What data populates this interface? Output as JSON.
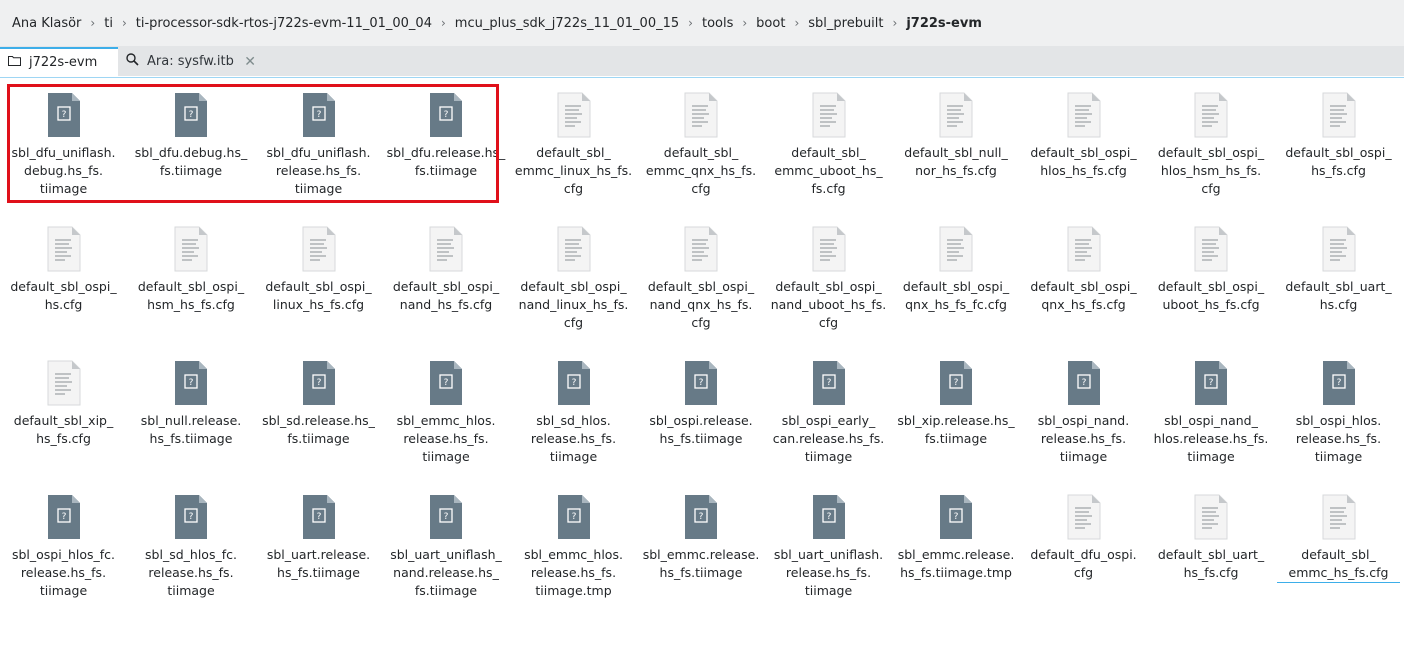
{
  "breadcrumb": {
    "items": [
      "Ana Klasör",
      "ti",
      "ti-processor-sdk-rtos-j722s-evm-11_01_00_04",
      "mcu_plus_sdk_j722s_11_01_00_15",
      "tools",
      "boot",
      "sbl_prebuilt",
      "j722s-evm"
    ],
    "separator": "›"
  },
  "tabs": [
    {
      "label": "j722s-evm",
      "icon": "folder-icon",
      "active": true
    },
    {
      "label": "Ara: sysfw.itb",
      "icon": "search-icon",
      "active": false,
      "close": "✕"
    }
  ],
  "colors": {
    "accent": "#3daee9",
    "selection": "#e0101a",
    "binary_icon": "#677a87",
    "text_icon": "#f5f5f5"
  },
  "files": [
    {
      "name": "sbl_dfu_uniflash.\ndebug.hs_fs.\ntiimage",
      "type": "binary"
    },
    {
      "name": "sbl_dfu.debug.hs_\nfs.tiimage",
      "type": "binary"
    },
    {
      "name": "sbl_dfu_uniflash.\nrelease.hs_fs.\ntiimage",
      "type": "binary"
    },
    {
      "name": "sbl_dfu.release.hs_\nfs.tiimage",
      "type": "binary"
    },
    {
      "name": "default_sbl_\nemmc_linux_hs_fs.\ncfg",
      "type": "text"
    },
    {
      "name": "default_sbl_\nemmc_qnx_hs_fs.\ncfg",
      "type": "text"
    },
    {
      "name": "default_sbl_\nemmc_uboot_hs_\nfs.cfg",
      "type": "text"
    },
    {
      "name": "default_sbl_null_\nnor_hs_fs.cfg",
      "type": "text"
    },
    {
      "name": "default_sbl_ospi_\nhlos_hs_fs.cfg",
      "type": "text"
    },
    {
      "name": "default_sbl_ospi_\nhlos_hsm_hs_fs.\ncfg",
      "type": "text"
    },
    {
      "name": "default_sbl_ospi_\nhs_fs.cfg",
      "type": "text"
    },
    {
      "name": "default_sbl_ospi_\nhs.cfg",
      "type": "text"
    },
    {
      "name": "default_sbl_ospi_\nhsm_hs_fs.cfg",
      "type": "text"
    },
    {
      "name": "default_sbl_ospi_\nlinux_hs_fs.cfg",
      "type": "text"
    },
    {
      "name": "default_sbl_ospi_\nnand_hs_fs.cfg",
      "type": "text"
    },
    {
      "name": "default_sbl_ospi_\nnand_linux_hs_fs.\ncfg",
      "type": "text"
    },
    {
      "name": "default_sbl_ospi_\nnand_qnx_hs_fs.\ncfg",
      "type": "text"
    },
    {
      "name": "default_sbl_ospi_\nnand_uboot_hs_fs.\ncfg",
      "type": "text"
    },
    {
      "name": "default_sbl_ospi_\nqnx_hs_fs_fc.cfg",
      "type": "text"
    },
    {
      "name": "default_sbl_ospi_\nqnx_hs_fs.cfg",
      "type": "text"
    },
    {
      "name": "default_sbl_ospi_\nuboot_hs_fs.cfg",
      "type": "text"
    },
    {
      "name": "default_sbl_uart_\nhs.cfg",
      "type": "text"
    },
    {
      "name": "default_sbl_xip_\nhs_fs.cfg",
      "type": "text"
    },
    {
      "name": "sbl_null.release.\nhs_fs.tiimage",
      "type": "binary"
    },
    {
      "name": "sbl_sd.release.hs_\nfs.tiimage",
      "type": "binary"
    },
    {
      "name": "sbl_emmc_hlos.\nrelease.hs_fs.\ntiimage",
      "type": "binary"
    },
    {
      "name": "sbl_sd_hlos.\nrelease.hs_fs.\ntiimage",
      "type": "binary"
    },
    {
      "name": "sbl_ospi.release.\nhs_fs.tiimage",
      "type": "binary"
    },
    {
      "name": "sbl_ospi_early_\ncan.release.hs_fs.\ntiimage",
      "type": "binary"
    },
    {
      "name": "sbl_xip.release.hs_\nfs.tiimage",
      "type": "binary"
    },
    {
      "name": "sbl_ospi_nand.\nrelease.hs_fs.\ntiimage",
      "type": "binary"
    },
    {
      "name": "sbl_ospi_nand_\nhlos.release.hs_fs.\ntiimage",
      "type": "binary"
    },
    {
      "name": "sbl_ospi_hlos.\nrelease.hs_fs.\ntiimage",
      "type": "binary"
    },
    {
      "name": "sbl_ospi_hlos_fc.\nrelease.hs_fs.\ntiimage",
      "type": "binary"
    },
    {
      "name": "sbl_sd_hlos_fc.\nrelease.hs_fs.\ntiimage",
      "type": "binary"
    },
    {
      "name": "sbl_uart.release.\nhs_fs.tiimage",
      "type": "binary"
    },
    {
      "name": "sbl_uart_uniflash_\nnand.release.hs_\nfs.tiimage",
      "type": "binary"
    },
    {
      "name": "sbl_emmc_hlos.\nrelease.hs_fs.\ntiimage.tmp",
      "type": "binary"
    },
    {
      "name": "sbl_emmc.release.\nhs_fs.tiimage",
      "type": "binary"
    },
    {
      "name": "sbl_uart_uniflash.\nrelease.hs_fs.\ntiimage",
      "type": "binary"
    },
    {
      "name": "sbl_emmc.release.\nhs_fs.tiimage.tmp",
      "type": "binary"
    },
    {
      "name": "default_dfu_ospi.\ncfg",
      "type": "text"
    },
    {
      "name": "default_sbl_uart_\nhs_fs.cfg",
      "type": "text"
    },
    {
      "name": "default_sbl_\nemmc_hs_fs.cfg",
      "type": "text",
      "focused": true
    }
  ]
}
